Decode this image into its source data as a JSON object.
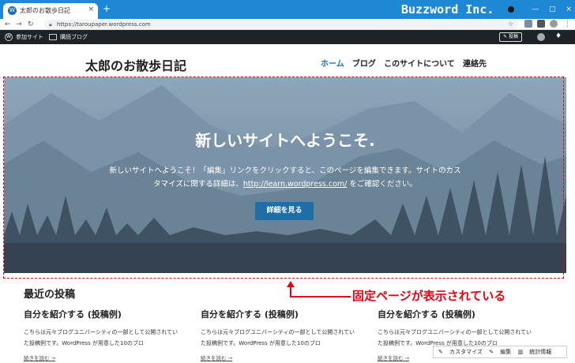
{
  "browser": {
    "tab_title": "太郎のお散歩日記",
    "tab_close": "×",
    "new_tab": "+",
    "brand": "Buzzword Inc.",
    "url": "https://taroupaper.wordpress.com",
    "win_minimize": "—",
    "win_maximize": "□",
    "win_close": "×"
  },
  "adminbar": {
    "my_sites": "参加サイト",
    "reader": "購読ブログ",
    "new_post": "投稿"
  },
  "site": {
    "title": "太郎のお散歩日記",
    "nav": [
      "ホーム",
      "ブログ",
      "このサイトについて",
      "連絡先"
    ],
    "nav_active_index": 0
  },
  "hero": {
    "title": "新しいサイトへようこそ.",
    "text_before": "新しいサイトへようこそ！「編集」リンクをクリックすると、このページを編集できます。サイトのカスタマイズに関する詳細は、",
    "link": "http://learn.wordpress.com/",
    "text_after": " をご確認ください。",
    "button": "詳細を見る"
  },
  "annotation": {
    "text": "固定ページが表示されている",
    "color": "#e60012"
  },
  "recent": {
    "heading": "最近の投稿",
    "posts": [
      {
        "title": "自分を紹介する (投稿例)",
        "excerpt": "こちらは元々ブログユニバーシティの一部として公開されていた投稿例です。WordPress が用意した10のブロ",
        "more": "続きを読む →"
      },
      {
        "title": "自分を紹介する (投稿例)",
        "excerpt": "こちらは元々ブログユニバーシティの一部として公開されていた投稿例です。WordPress が用意した10のブロ",
        "more": "続きを読む →"
      },
      {
        "title": "自分を紹介する (投稿例)",
        "excerpt": "こちらは元々ブログユニバーシティの一部として公開されていた投稿例です。WordPress が用意した10のブロ",
        "more": "続きを読む →"
      }
    ]
  },
  "custombar": {
    "customize": "カスタマイズ",
    "edit": "編集",
    "stats": "統計情報"
  },
  "colors": {
    "browser_bar": "#1e88d6",
    "admin_bar": "#1d2327",
    "accent": "#1e6ea8"
  }
}
